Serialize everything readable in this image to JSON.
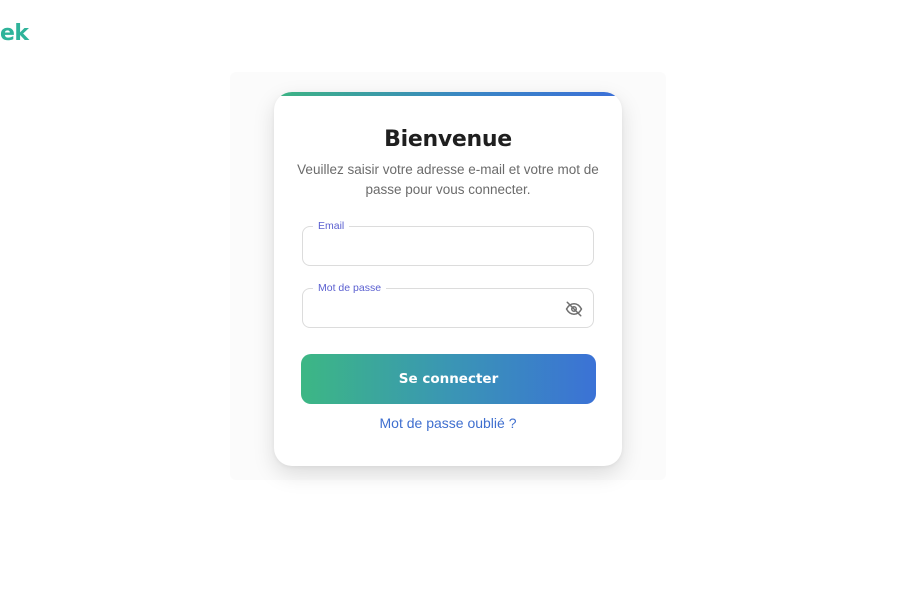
{
  "brand": {
    "logo_text": "ek",
    "color": "#2fb39a"
  },
  "login": {
    "title": "Bienvenue",
    "subtitle": "Veuillez saisir votre adresse e-mail et votre mot de passe pour vous connecter.",
    "email": {
      "label": "Email",
      "value": "",
      "placeholder": ""
    },
    "password": {
      "label": "Mot de passe",
      "value": "",
      "placeholder": "",
      "toggle_icon": "eye-off-icon"
    },
    "submit_label": "Se connecter",
    "forgot_label": "Mot de passe oublié ?"
  },
  "colors": {
    "gradient_start": "#3cb784",
    "gradient_end": "#3b72d6",
    "label": "#5a5fd0",
    "link": "#3f6fcf"
  }
}
